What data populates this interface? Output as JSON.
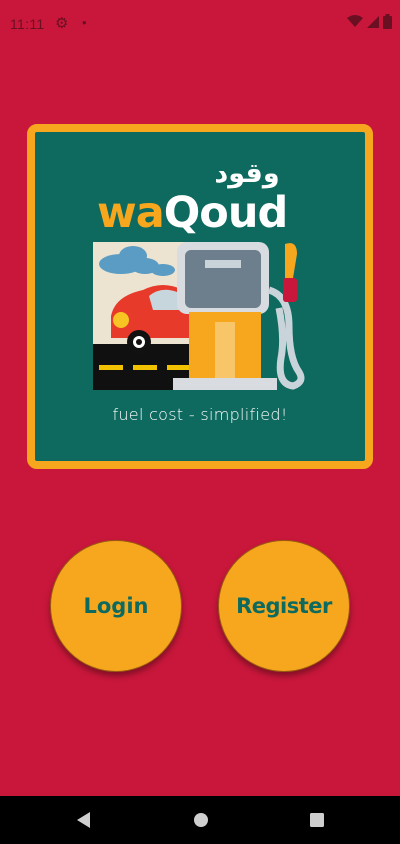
{
  "status_bar": {
    "time": "11:11",
    "gear_icon": "⚙",
    "dot": "•",
    "color": "#6b0f22"
  },
  "logo": {
    "arabic_name": "وقود",
    "wordmark_wa": "wa",
    "wordmark_qoud": "Qoud",
    "tagline": "fuel cost - simplified!"
  },
  "buttons": {
    "login_label": "Login",
    "register_label": "Register"
  },
  "colors": {
    "background": "#c8173a",
    "card_fill": "#0e6a5e",
    "card_border": "#f7a71e",
    "button_fill": "#f7a71e",
    "button_text": "#0e6a5e"
  }
}
